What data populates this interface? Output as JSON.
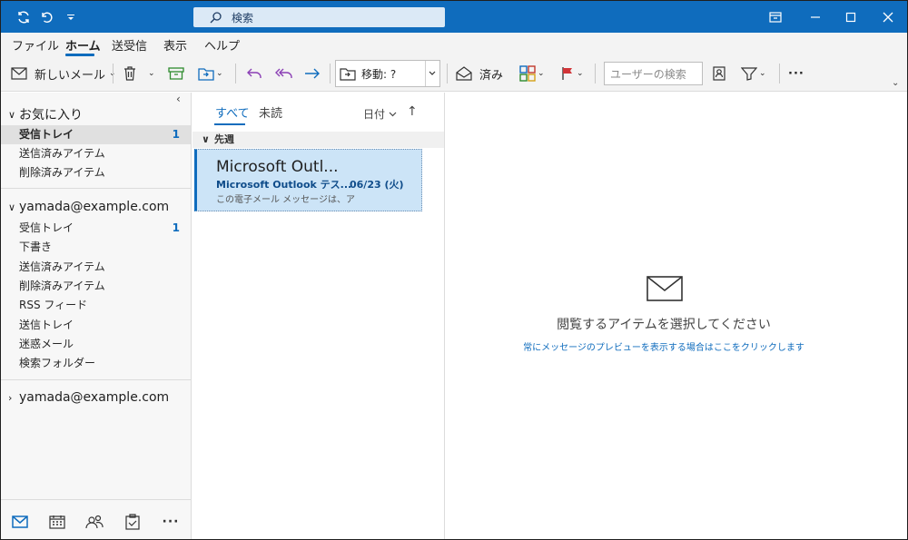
{
  "titlebar": {
    "search_placeholder": "検索",
    "accent": "#0f6cbd"
  },
  "menu": {
    "items": [
      "ファイル",
      "ホーム",
      "送受信",
      "表示",
      "ヘルプ"
    ],
    "active": "ホーム"
  },
  "ribbon": {
    "new_mail": "新しいメール",
    "move_label": "移動: ?",
    "read_label": "済み",
    "people_search_placeholder": "ユーザーの検索",
    "more": "···"
  },
  "folders": {
    "favorites": {
      "label": "お気に入り",
      "items": [
        {
          "label": "受信トレイ",
          "count": "1"
        },
        {
          "label": "送信済みアイテム",
          "count": ""
        },
        {
          "label": "削除済みアイテム",
          "count": ""
        }
      ]
    },
    "account1": {
      "label": "yamada@example.com",
      "items": [
        {
          "label": "受信トレイ",
          "count": "1"
        },
        {
          "label": "下書き",
          "count": ""
        },
        {
          "label": "送信済みアイテム",
          "count": ""
        },
        {
          "label": "削除済みアイテム",
          "count": ""
        },
        {
          "label": "RSS フィード",
          "count": ""
        },
        {
          "label": "送信トレイ",
          "count": ""
        },
        {
          "label": "迷惑メール",
          "count": ""
        },
        {
          "label": "検索フォルダー",
          "count": ""
        }
      ]
    },
    "account2": {
      "label": "yamada@example.com"
    }
  },
  "message_list": {
    "tabs": [
      "すべて",
      "未読"
    ],
    "sort_label": "日付",
    "group": "先週",
    "messages": [
      {
        "sender": "Microsoft Outl...",
        "subject": "Microsoft Outlook テス...",
        "date": "06/23 (火)",
        "preview": "この電子メール メッセージは、ア"
      }
    ]
  },
  "reading_pane": {
    "title": "閲覧するアイテムを選択してください",
    "link": "常にメッセージのプレビューを表示する場合はここをクリックします"
  }
}
